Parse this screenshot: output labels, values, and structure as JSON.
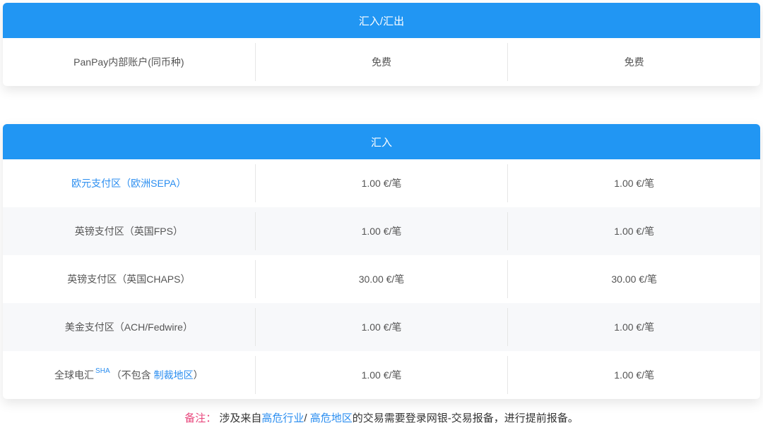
{
  "section1": {
    "title": "汇入/汇出",
    "rows": [
      {
        "name": "PanPay内部账户(同币种)",
        "fee_a": "免费",
        "fee_b": "免费"
      }
    ]
  },
  "section2": {
    "title": "汇入",
    "rows": [
      {
        "name": "欧元支付区（欧洲SEPA）",
        "fee_a": "1.00 €/笔",
        "fee_b": "1.00 €/笔"
      },
      {
        "name": "英镑支付区（英国FPS）",
        "fee_a": "1.00 €/笔",
        "fee_b": "1.00 €/笔"
      },
      {
        "name": "英镑支付区（英国CHAPS）",
        "fee_a": "30.00 €/笔",
        "fee_b": "30.00 €/笔"
      },
      {
        "name": "美金支付区（ACH/Fedwire）",
        "fee_a": "1.00 €/笔",
        "fee_b": "1.00 €/笔"
      },
      {
        "name_prefix": "全球电汇",
        "name_sup": "SHA",
        "name_mid": "（不包含",
        "name_link": "制裁地区",
        "name_suffix": "）",
        "fee_a": "1.00 €/笔",
        "fee_b": "1.00 €/笔"
      }
    ]
  },
  "note": {
    "prefix": "备注：",
    "text1": "涉及来自",
    "link1": "高危行业",
    "sep": "/",
    "link2": "高危地区",
    "text2": "的交易需要登录网银-交易报备，进行提前报备。"
  },
  "colors": {
    "header_bg": "#2196f3",
    "link": "#2b8ef0",
    "note_prefix": "#e8467c"
  }
}
